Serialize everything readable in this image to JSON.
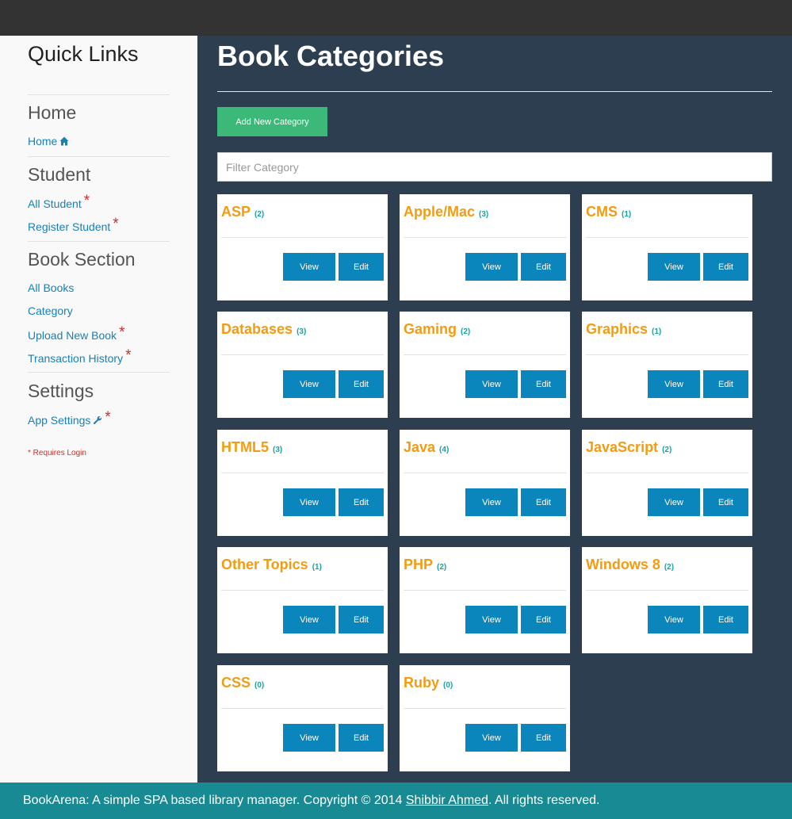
{
  "sidebar": {
    "title": "Quick Links",
    "sections": [
      {
        "heading": "Home",
        "links": [
          {
            "label": "Home",
            "icon": "home-icon",
            "requires_login": false
          }
        ]
      },
      {
        "heading": "Student",
        "links": [
          {
            "label": "All Student",
            "requires_login": true
          },
          {
            "label": "Register Student",
            "requires_login": true
          }
        ]
      },
      {
        "heading": "Book Section",
        "links": [
          {
            "label": "All Books",
            "requires_login": false
          },
          {
            "label": "Category",
            "requires_login": false
          },
          {
            "label": "Upload New Book",
            "requires_login": true
          },
          {
            "label": "Transaction History",
            "requires_login": true
          }
        ]
      },
      {
        "heading": "Settings",
        "links": [
          {
            "label": "App Settings",
            "icon": "wrench-icon",
            "requires_login": true
          }
        ]
      }
    ],
    "star": "*",
    "note": "* Requires Login"
  },
  "main": {
    "title": "Book Categories",
    "add_button": "Add New Category",
    "filter_placeholder": "Filter Category",
    "view_label": "View",
    "edit_label": "Edit",
    "categories": [
      {
        "name": "ASP",
        "count": "(2)"
      },
      {
        "name": "Apple/Mac",
        "count": "(3)"
      },
      {
        "name": "CMS",
        "count": "(1)"
      },
      {
        "name": "Databases",
        "count": "(3)"
      },
      {
        "name": "Gaming",
        "count": "(2)"
      },
      {
        "name": "Graphics",
        "count": "(1)"
      },
      {
        "name": "HTML5",
        "count": "(3)"
      },
      {
        "name": "Java",
        "count": "(4)"
      },
      {
        "name": "JavaScript",
        "count": "(2)"
      },
      {
        "name": "Other Topics",
        "count": "(1)"
      },
      {
        "name": "PHP",
        "count": "(2)"
      },
      {
        "name": "Windows 8",
        "count": "(2)"
      },
      {
        "name": "CSS",
        "count": "(0)"
      },
      {
        "name": "Ruby",
        "count": "(0)"
      }
    ]
  },
  "footer": {
    "prefix": "BookArena: A simple SPA based library manager. Copyright © 2014 ",
    "author": "Shibbir Ahmed",
    "suffix": ". All rights reserved."
  },
  "colors": {
    "content_bg": "#2d3e50",
    "topbar": "#333333",
    "accent_button": "#0a86bd",
    "add_button": "#3cb878",
    "category_name": "#f39c12",
    "footer": "#178a93"
  }
}
